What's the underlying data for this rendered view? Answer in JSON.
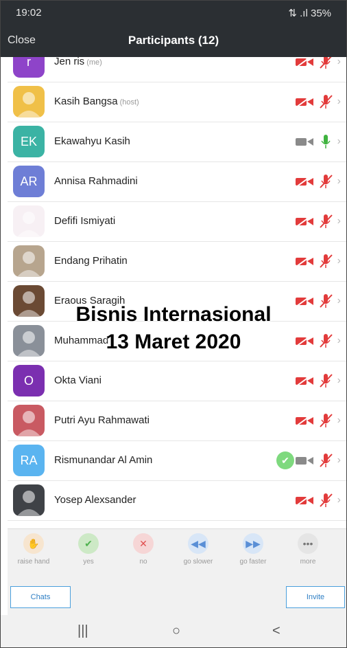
{
  "status_bar": {
    "time": "19:02",
    "indicators": "⇅ .ıl 35%",
    "battery_icon": "battery-icon"
  },
  "header": {
    "close_label": "Close",
    "title": "Participants (12)"
  },
  "participants": [
    {
      "name": "Jen ris",
      "tag": "(me)",
      "avatar_text": "r",
      "avatar_color": "#8e44c9",
      "video": "off",
      "audio": "muted"
    },
    {
      "name": "Kasih Bangsa",
      "tag": "(host)",
      "avatar_text": "",
      "avatar_color": "#f0c048",
      "video": "off",
      "audio": "muted"
    },
    {
      "name": "Ekawahyu Kasih",
      "tag": "",
      "avatar_text": "EK",
      "avatar_color": "#3bb3a4",
      "video": "on",
      "audio": "on"
    },
    {
      "name": "Annisa Rahmadini",
      "tag": "",
      "avatar_text": "AR",
      "avatar_color": "#6e7ed6",
      "video": "off",
      "audio": "muted"
    },
    {
      "name": "Defifi Ismiyati",
      "tag": "",
      "avatar_text": "",
      "avatar_color": "#f7f0f4",
      "video": "off",
      "audio": "muted"
    },
    {
      "name": "Endang Prihatin",
      "tag": "",
      "avatar_text": "",
      "avatar_color": "#b7a58e",
      "video": "off",
      "audio": "muted"
    },
    {
      "name": "Eraous Saragih",
      "tag": "",
      "avatar_text": "",
      "avatar_color": "#6b4a34",
      "video": "off",
      "audio": "muted"
    },
    {
      "name": "Muhammad",
      "tag": "",
      "avatar_text": "",
      "avatar_color": "#8a9099",
      "video": "off",
      "audio": "muted"
    },
    {
      "name": "Okta Viani",
      "tag": "",
      "avatar_text": "O",
      "avatar_color": "#7b2fb0",
      "video": "off",
      "audio": "muted"
    },
    {
      "name": "Putri Ayu Rahmawati",
      "tag": "",
      "avatar_text": "",
      "avatar_color": "#c95a62",
      "video": "off",
      "audio": "muted"
    },
    {
      "name": "Rismunandar Al Amin",
      "tag": "",
      "avatar_text": "RA",
      "avatar_color": "#5ab4f0",
      "video": "on",
      "audio": "muted",
      "check": true
    },
    {
      "name": "Yosep Alexsander",
      "tag": "",
      "avatar_text": "",
      "avatar_color": "#3f4247",
      "video": "off",
      "audio": "muted"
    }
  ],
  "overlay": {
    "line1": "Bisnis Internasional",
    "line2": "13 Maret 2020"
  },
  "reactions": [
    {
      "label": "raise hand",
      "icon": "raise-hand-icon",
      "glyph": "✋",
      "bg": "#f7e5cf",
      "fg": "#e0a55b"
    },
    {
      "label": "yes",
      "icon": "yes-icon",
      "glyph": "✔",
      "bg": "#cde9c6",
      "fg": "#4fb24f"
    },
    {
      "label": "no",
      "icon": "no-icon",
      "glyph": "✕",
      "bg": "#f6d6d6",
      "fg": "#e05050"
    },
    {
      "label": "go slower",
      "icon": "go-slower-icon",
      "glyph": "◀◀",
      "bg": "#d8e6f7",
      "fg": "#5a8fd6"
    },
    {
      "label": "go faster",
      "icon": "go-faster-icon",
      "glyph": "▶▶",
      "bg": "#d8e6f7",
      "fg": "#5a8fd6"
    },
    {
      "label": "more",
      "icon": "more-icon",
      "glyph": "•••",
      "bg": "#e5e5e5",
      "fg": "#777"
    }
  ],
  "buttons": {
    "chats": "Chats",
    "invite": "Invite"
  },
  "nav": {
    "recents": "|||",
    "home": "○",
    "back": "<"
  }
}
